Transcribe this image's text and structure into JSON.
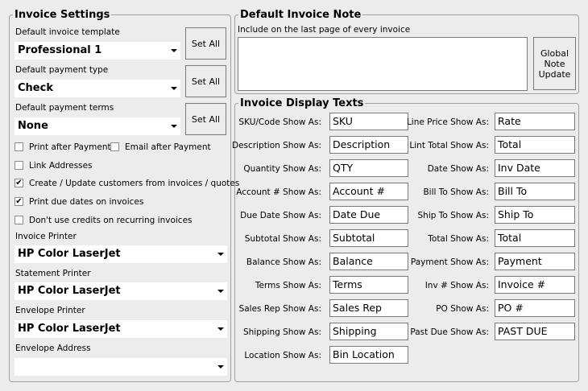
{
  "invoice_settings": {
    "title": "Invoice Settings",
    "template_label": "Default invoice template",
    "template_value": "Professional 1",
    "payment_type_label": "Default payment type",
    "payment_type_value": "Check",
    "payment_terms_label": "Default payment terms",
    "payment_terms_value": "None",
    "set_all_label": "Set All",
    "checkboxes": [
      {
        "label": "Print after Payment",
        "checked": false
      },
      {
        "label": "Email after Payment",
        "checked": false
      },
      {
        "label": "Link Addresses",
        "checked": false
      },
      {
        "label": "Create / Update customers from invoices /  quotes",
        "checked": true
      },
      {
        "label": "Print due dates on invoices",
        "checked": true
      },
      {
        "label": "Don't use credits on recurring invoices",
        "checked": false
      }
    ],
    "check_mark": "✔",
    "invoice_printer_label": "Invoice Printer",
    "invoice_printer_value": "HP Color LaserJet",
    "statement_printer_label": "Statement Printer",
    "statement_printer_value": "HP Color LaserJet",
    "envelope_printer_label": "Envelope Printer",
    "envelope_printer_value": "HP Color LaserJet",
    "envelope_address_label": "Envelope Address",
    "envelope_address_value": ""
  },
  "invoice_note": {
    "title": "Default Invoice Note",
    "include_label": "Include on the last page of every invoice",
    "note_value": "",
    "global_button": "Global Note Update"
  },
  "display_texts": {
    "title": "Invoice Display Texts",
    "left": [
      {
        "label": "SKU/Code Show As:",
        "value": "SKU"
      },
      {
        "label": "Description Show As:",
        "value": "Description"
      },
      {
        "label": "Quantity Show As:",
        "value": "QTY"
      },
      {
        "label": "Account # Show As:",
        "value": "Account #"
      },
      {
        "label": "Due Date Show As:",
        "value": "Date Due"
      },
      {
        "label": "Subtotal Show As:",
        "value": "Subtotal"
      },
      {
        "label": "Balance Show As:",
        "value": "Balance"
      },
      {
        "label": "Terms Show As:",
        "value": "Terms"
      },
      {
        "label": "Sales Rep Show As:",
        "value": "Sales Rep"
      },
      {
        "label": "Shipping Show As:",
        "value": "Shipping"
      },
      {
        "label": "Location Show As:",
        "value": "Bin Location"
      }
    ],
    "right": [
      {
        "label": "Line Price Show As:",
        "value": "Rate"
      },
      {
        "label": "Lint Total Show As:",
        "value": "Total"
      },
      {
        "label": "Date Show As:",
        "value": "Inv Date"
      },
      {
        "label": "Bill To Show As:",
        "value": "Bill To"
      },
      {
        "label": "Ship To Show As:",
        "value": "Ship To"
      },
      {
        "label": "Total Show As:",
        "value": "Total"
      },
      {
        "label": "Payment Show As:",
        "value": "Payment"
      },
      {
        "label": "Inv # Show As:",
        "value": "Invoice #"
      },
      {
        "label": "PO Show As:",
        "value": "PO #"
      },
      {
        "label": "Past Due Show As:",
        "value": "PAST DUE"
      }
    ]
  }
}
